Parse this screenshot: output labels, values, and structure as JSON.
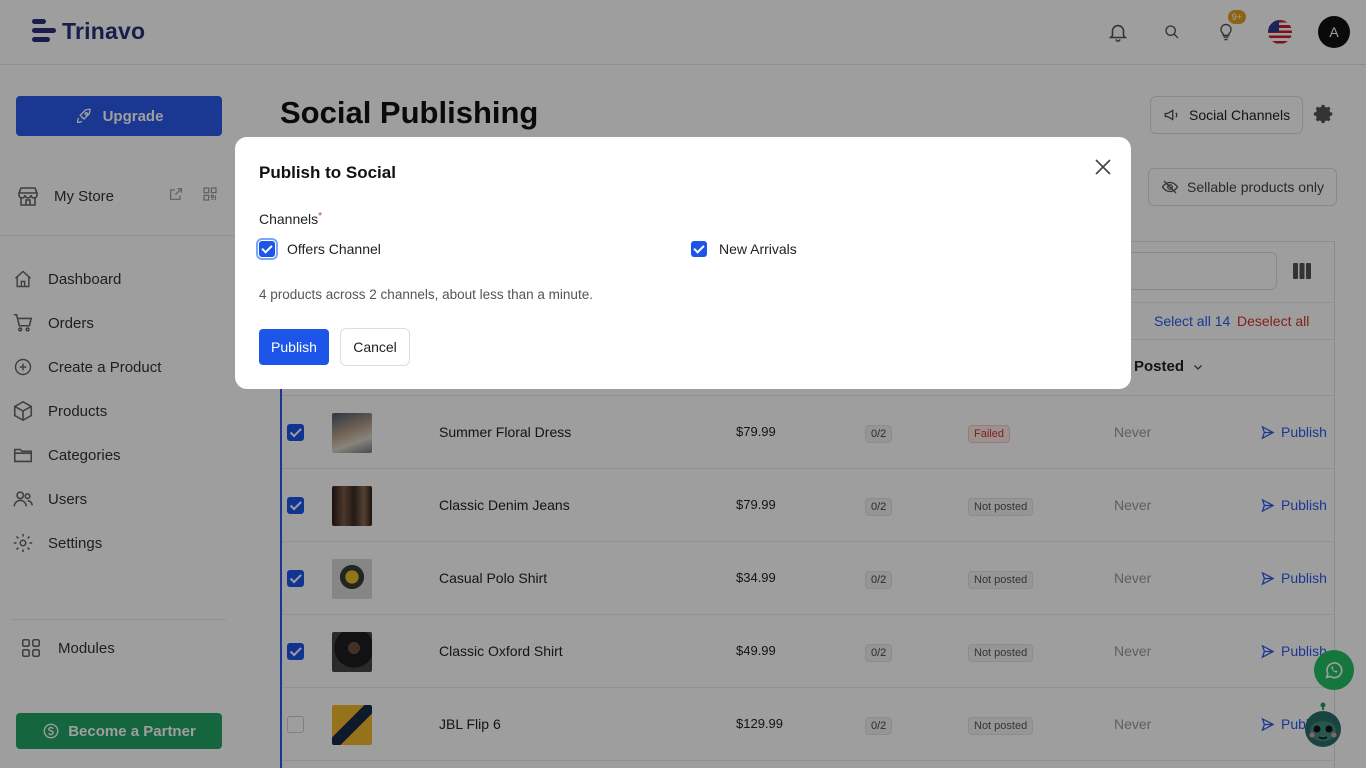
{
  "app": {
    "name": "Trinavo"
  },
  "topbar": {
    "notifications_badge": "9+",
    "avatar_initial": "A"
  },
  "sidebar": {
    "upgrade_label": "Upgrade",
    "store_label": "My Store",
    "nav": [
      {
        "label": "Dashboard",
        "icon": "home-icon"
      },
      {
        "label": "Orders",
        "icon": "cart-icon"
      },
      {
        "label": "Create a Product",
        "icon": "plus-circle-icon"
      },
      {
        "label": "Products",
        "icon": "box-icon"
      },
      {
        "label": "Categories",
        "icon": "folder-icon"
      },
      {
        "label": "Users",
        "icon": "users-icon"
      },
      {
        "label": "Settings",
        "icon": "gear-icon"
      }
    ],
    "modules_label": "Modules",
    "partner_label": "Become a Partner"
  },
  "page": {
    "title": "Social Publishing",
    "social_channels_label": "Social Channels",
    "sellable_label": "Sellable products only",
    "select_all_label": "Select all 14",
    "deselect_all_label": "Deselect all",
    "posted_header": "Posted"
  },
  "products": [
    {
      "name": "Summer Floral Dress",
      "price": "$79.99",
      "count": "0/2",
      "status": "Failed",
      "last": "Never",
      "action": "Publish",
      "checked": true
    },
    {
      "name": "Classic Denim Jeans",
      "price": "$79.99",
      "count": "0/2",
      "status": "Not posted",
      "last": "Never",
      "action": "Publish",
      "checked": true
    },
    {
      "name": "Casual Polo Shirt",
      "price": "$34.99",
      "count": "0/2",
      "status": "Not posted",
      "last": "Never",
      "action": "Publish",
      "checked": true
    },
    {
      "name": "Classic Oxford Shirt",
      "price": "$49.99",
      "count": "0/2",
      "status": "Not posted",
      "last": "Never",
      "action": "Publish",
      "checked": true
    },
    {
      "name": "JBL Flip 6",
      "price": "$129.99",
      "count": "0/2",
      "status": "Not posted",
      "last": "Never",
      "action": "Publish",
      "checked": false
    }
  ],
  "modal": {
    "title": "Publish to Social",
    "channels_label": "Channels",
    "required_mark": "*",
    "options": [
      {
        "label": "Offers Channel",
        "checked": true
      },
      {
        "label": "New Arrivals",
        "checked": true
      }
    ],
    "summary": "4 products across 2 channels, about less than a minute.",
    "publish_label": "Publish",
    "cancel_label": "Cancel"
  },
  "colors": {
    "primary": "#1c55e8",
    "partner": "#22a464",
    "danger": "#d0362f",
    "brand": "#2a2f7a"
  }
}
